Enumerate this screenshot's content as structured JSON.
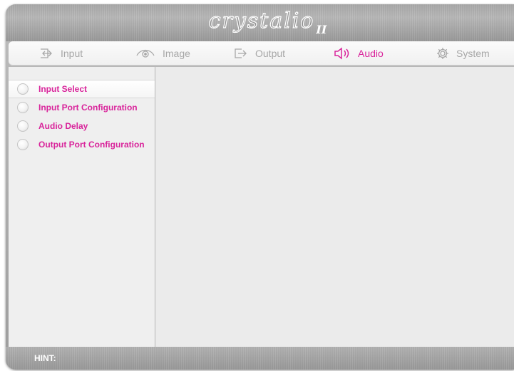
{
  "logo": {
    "text": "crystalio",
    "suffix": "II"
  },
  "tabs": [
    {
      "label": "Input",
      "icon": "input-arrow-icon",
      "active": false
    },
    {
      "label": "Image",
      "icon": "eye-icon",
      "active": false
    },
    {
      "label": "Output",
      "icon": "output-arrow-icon",
      "active": false
    },
    {
      "label": "Audio",
      "icon": "speaker-icon",
      "active": true
    },
    {
      "label": "System",
      "icon": "gear-icon",
      "active": false
    }
  ],
  "sidebar": {
    "items": [
      {
        "label": "Input Select",
        "selected": true
      },
      {
        "label": "Input Port Configuration",
        "selected": false
      },
      {
        "label": "Audio Delay",
        "selected": false
      },
      {
        "label": "Output Port Configuration",
        "selected": false
      }
    ]
  },
  "hint": {
    "label": "HINT:"
  },
  "colors": {
    "accent": "#d9249b",
    "inactive_tab": "#a7a7a7",
    "chrome": "#a8a8a8"
  }
}
